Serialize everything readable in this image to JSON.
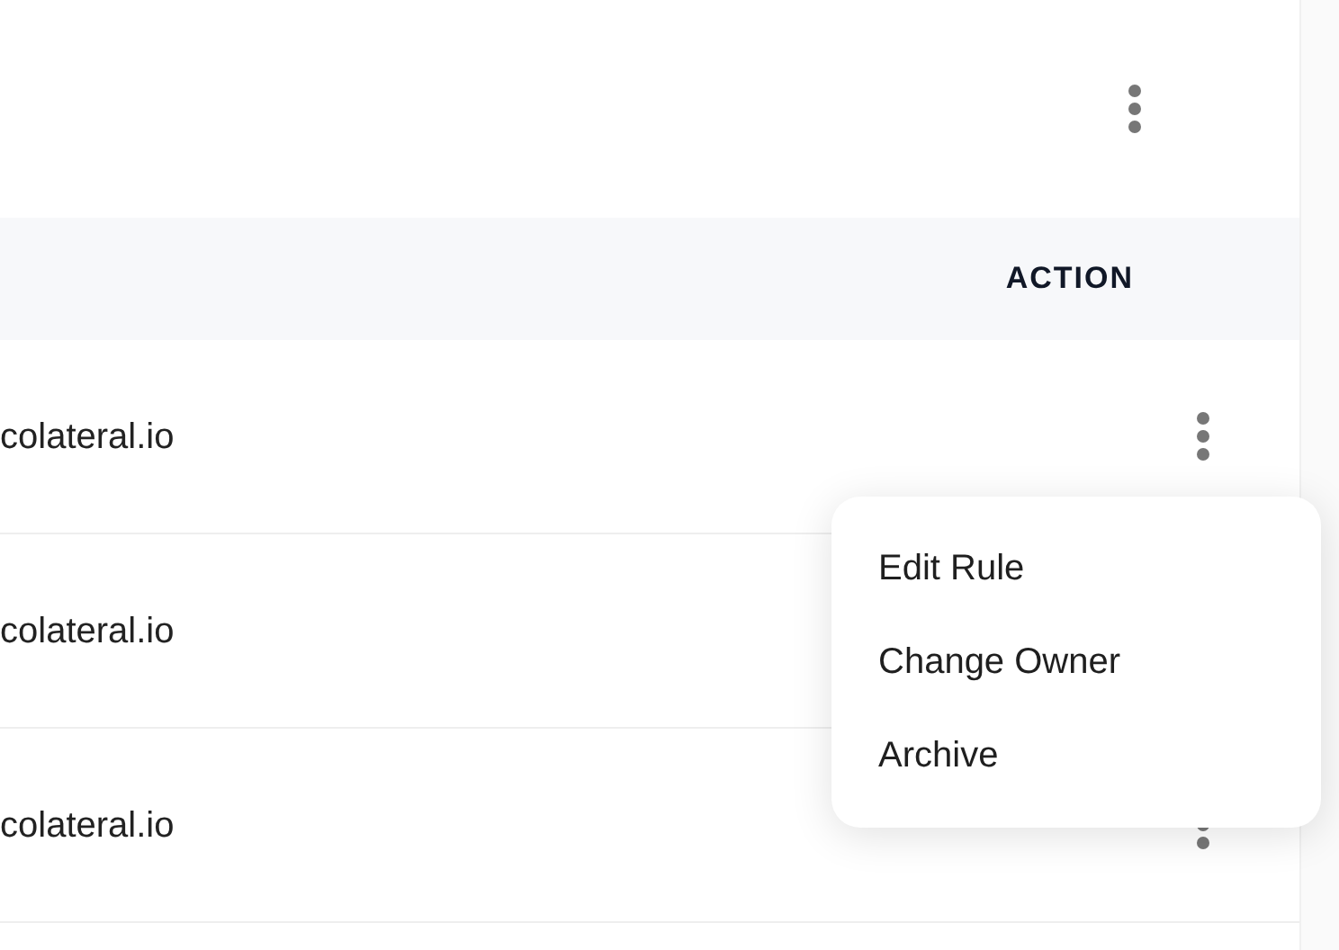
{
  "table": {
    "columns": [
      "ACTION"
    ],
    "rows": [
      {
        "cell": "colateral.io"
      },
      {
        "cell": "colateral.io"
      },
      {
        "cell": "colateral.io"
      }
    ]
  },
  "context_menu": {
    "items": [
      "Edit Rule",
      "Change Owner",
      "Archive"
    ]
  }
}
